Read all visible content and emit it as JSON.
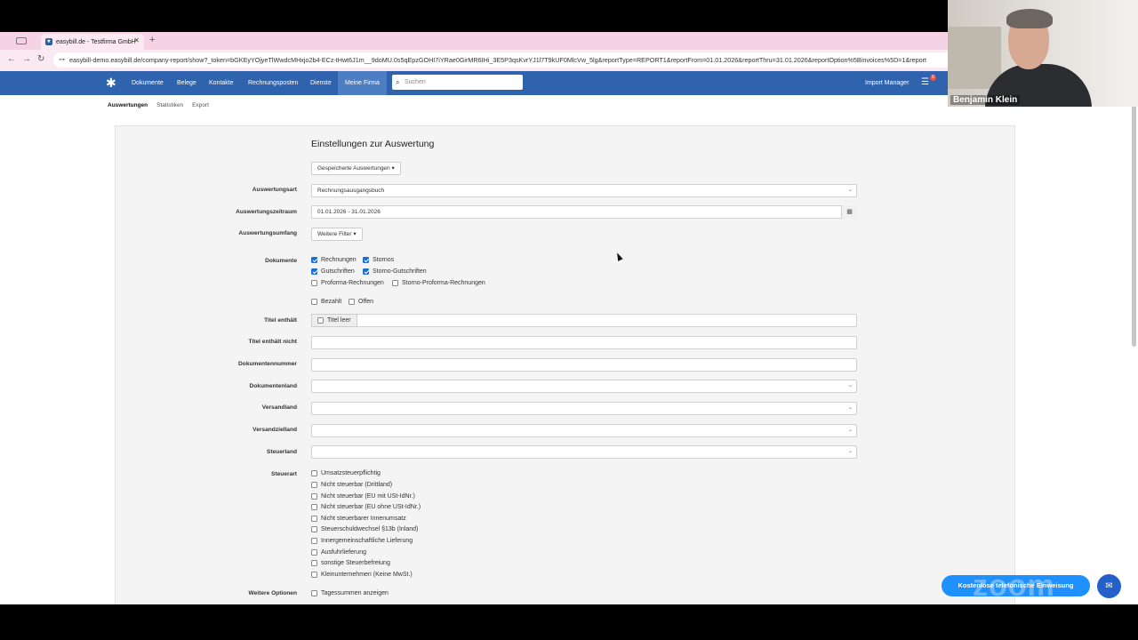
{
  "browser": {
    "tab_title": "easybill.de - Testfirma GmbH",
    "tab_close": "✕",
    "new_tab": "+",
    "url": "easybill-demo.easybill.de/company-report/show?_token=bGKEyYOjyeTlWwdcMHxjo2b4-ECz-tHwt6J1m__9doMU.0s5qEpzGOHI7iYRae0GirMR6IHi_3E5P3qsKvrYJ1l7T9kUF0MlcVw_5lg&reportType=REPORT1&reportFrom=01.01.2026&reportThru=31.01.2026&reportOption%5Binvoices%5D=1&report"
  },
  "appnav": {
    "items": [
      "Dokumente",
      "Belege",
      "Kontakte",
      "Rechnungsposten",
      "Dienste",
      "Meine Firma"
    ],
    "search_placeholder": "Suchen",
    "import_manager": "Import Manager",
    "badge_count": "6"
  },
  "subnav": [
    "Auswertungen",
    "Statistiken",
    "Export"
  ],
  "form": {
    "heading": "Einstellungen zur Auswertung",
    "saved_reports": "Gespeicherte Auswertungen ▾",
    "auswertungsart_label": "Auswertungsart",
    "auswertungsart_value": "Rechnungsausgangsbuch",
    "zeitraum_label": "Auswertungszeitraum",
    "zeitraum_value": "01.01.2026 - 31.01.2026",
    "umfang_label": "Auswertungsumfang",
    "weitere_filter": "Weitere Filter ▾",
    "dokumente_label": "Dokumente",
    "dokumente": [
      {
        "label": "Rechnungen",
        "checked": true
      },
      {
        "label": "Stornos",
        "checked": true
      },
      {
        "label": "Gutschriften",
        "checked": true
      },
      {
        "label": "Storno-Gutschriften",
        "checked": true
      },
      {
        "label": "Proforma-Rechnungen",
        "checked": false
      },
      {
        "label": "Storno-Proforma-Rechnungen",
        "checked": false
      }
    ],
    "bezahlt": "Bezahlt",
    "offen": "Offen",
    "titel_enthaelt_label": "Titel enthält",
    "titel_leer": "Titel leer",
    "titel_nicht_label": "Titel enthält nicht",
    "dokumentennummer_label": "Dokumentennummer",
    "dokumentenland_label": "Dokumentenland",
    "versandland_label": "Versandland",
    "versandzielland_label": "Versandzielland",
    "steuerland_label": "Steuerland",
    "steuerart_label": "Steuerart",
    "steuerarten": [
      "Umsatzsteuerpflichtig",
      "Nicht steuerbar (Drittland)",
      "Nicht steuerbar (EU mit USt-IdNr.)",
      "Nicht steuerbar (EU ohne USt-IdNr.)",
      "Nicht steuerbarer Innenumsatz",
      "Steuerschuldwechsel §13b (Inland)",
      "Innergemeinschaftliche Lieferung",
      "Ausfuhrlieferung",
      "sonstige Steuerbefreiung",
      "Kleinunternehmen (Keine MwSt.)"
    ],
    "weitere_optionen_label": "Weitere Optionen",
    "tagessummen": "Tagessummen anzeigen"
  },
  "webcam": {
    "name": "Benjamin Klein"
  },
  "floating": {
    "phone_button": "Kostenlose telefonische Einweisung",
    "zoom_watermark": "zoom"
  }
}
